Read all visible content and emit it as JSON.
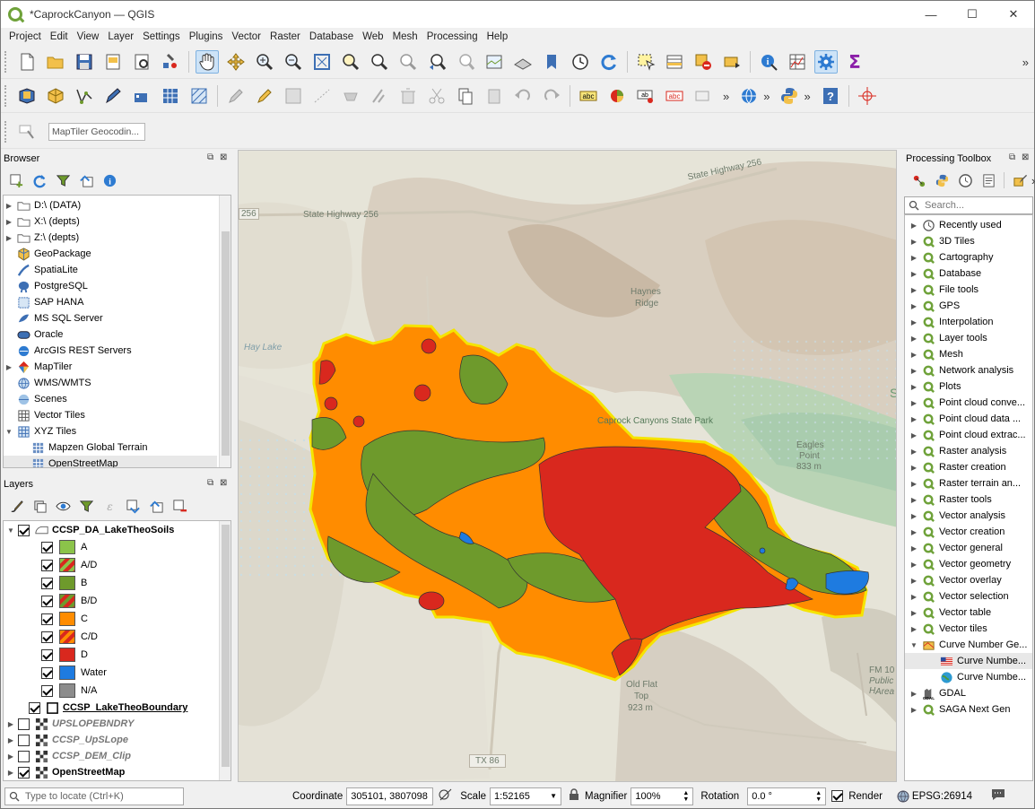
{
  "window": {
    "title": "*CaprockCanyon — QGIS",
    "minimize": "—",
    "maximize": "☐",
    "close": "✕"
  },
  "menu": [
    "Project",
    "Edit",
    "View",
    "Layer",
    "Settings",
    "Plugins",
    "Vector",
    "Raster",
    "Database",
    "Web",
    "Mesh",
    "Processing",
    "Help"
  ],
  "toolbar3": {
    "geocoding_placeholder": "MapTiler Geocodin..."
  },
  "browser": {
    "title": "Browser",
    "items": [
      {
        "label": "D:\\ (DATA)",
        "icon": "folder-icon",
        "arrow": "▶",
        "indent": 0
      },
      {
        "label": "X:\\ (depts)",
        "icon": "folder-icon",
        "arrow": "▶",
        "indent": 0
      },
      {
        "label": "Z:\\ (depts)",
        "icon": "folder-icon",
        "arrow": "▶",
        "indent": 0
      },
      {
        "label": "GeoPackage",
        "icon": "geopackage-icon",
        "arrow": "",
        "indent": 0
      },
      {
        "label": "SpatiaLite",
        "icon": "spatialite-icon",
        "arrow": "",
        "indent": 0
      },
      {
        "label": "PostgreSQL",
        "icon": "postgresql-icon",
        "arrow": "",
        "indent": 0
      },
      {
        "label": "SAP HANA",
        "icon": "sap-hana-icon",
        "arrow": "",
        "indent": 0
      },
      {
        "label": "MS SQL Server",
        "icon": "mssql-icon",
        "arrow": "",
        "indent": 0
      },
      {
        "label": "Oracle",
        "icon": "oracle-icon",
        "arrow": "",
        "indent": 0
      },
      {
        "label": "ArcGIS REST Servers",
        "icon": "arcgis-icon",
        "arrow": "",
        "indent": 0
      },
      {
        "label": "MapTiler",
        "icon": "maptiler-icon",
        "arrow": "▶",
        "indent": 0
      },
      {
        "label": "WMS/WMTS",
        "icon": "wms-icon",
        "arrow": "",
        "indent": 0
      },
      {
        "label": "Scenes",
        "icon": "scenes-icon",
        "arrow": "",
        "indent": 0
      },
      {
        "label": "Vector Tiles",
        "icon": "vector-tiles-icon",
        "arrow": "",
        "indent": 0
      },
      {
        "label": "XYZ Tiles",
        "icon": "xyz-tiles-icon",
        "arrow": "▼",
        "indent": 0
      },
      {
        "label": "Mapzen Global Terrain",
        "icon": "tile-layer-icon",
        "arrow": "",
        "indent": 1
      },
      {
        "label": "OpenStreetMap",
        "icon": "tile-layer-icon",
        "arrow": "",
        "indent": 1
      }
    ]
  },
  "layers": {
    "title": "Layers",
    "items": [
      {
        "label": "CCSP_DA_LakeTheoSoils",
        "type": "group-layer",
        "checked": true,
        "bold": true,
        "italic": false
      },
      {
        "label": "A",
        "type": "class",
        "checked": true,
        "color": "#8bc34a",
        "color2": ""
      },
      {
        "label": "A/D",
        "type": "class",
        "checked": true,
        "color": "#8bc34a",
        "color2": "#d9281e"
      },
      {
        "label": "B",
        "type": "class",
        "checked": true,
        "color": "#6e9a2c",
        "color2": ""
      },
      {
        "label": "B/D",
        "type": "class",
        "checked": true,
        "color": "#6e9a2c",
        "color2": "#d9281e"
      },
      {
        "label": "C",
        "type": "class",
        "checked": true,
        "color": "#ff8c00",
        "color2": ""
      },
      {
        "label": "C/D",
        "type": "class",
        "checked": true,
        "color": "#ff8c00",
        "color2": "#d9281e"
      },
      {
        "label": "D",
        "type": "class",
        "checked": true,
        "color": "#d9281e",
        "color2": ""
      },
      {
        "label": "Water",
        "type": "class",
        "checked": true,
        "color": "#1e7be0",
        "color2": ""
      },
      {
        "label": "N/A",
        "type": "class",
        "checked": true,
        "color": "#8c8c8c",
        "color2": ""
      },
      {
        "label": "CCSP_LakeTheoBoundary",
        "type": "polygon-layer",
        "checked": true,
        "bold": true,
        "italic": false
      },
      {
        "label": "UPSLOPEBNDRY",
        "type": "raster-layer",
        "checked": false,
        "bold": true,
        "italic": true
      },
      {
        "label": "CCSP_UpSLope",
        "type": "raster-layer",
        "checked": false,
        "bold": true,
        "italic": true
      },
      {
        "label": "CCSP_DEM_Clip",
        "type": "raster-layer",
        "checked": false,
        "bold": true,
        "italic": true
      },
      {
        "label": "OpenStreetMap",
        "type": "raster-layer",
        "checked": true,
        "bold": true,
        "italic": false
      }
    ]
  },
  "map_labels": {
    "highway_top": "State Highway 256",
    "highway_mid": "State Highway 256",
    "shield_256": "256",
    "hay_lake": "Hay Lake",
    "haynes_1": "Haynes",
    "haynes_2": "Ridge",
    "park": "Caprock Canyons State Park",
    "eagles_1": "Eagles",
    "eagles_2": "Point",
    "eagles_3": "833 m",
    "oldflat_1": "Old Flat",
    "oldflat_2": "Top",
    "oldflat_3": "923 m",
    "fm_1": "FM 10",
    "fm_2": "Public H",
    "fm_3": "Area",
    "tx86": "TX 86",
    "edge_s": "S"
  },
  "toolbox": {
    "title": "Processing Toolbox",
    "search_placeholder": "Search...",
    "items": [
      {
        "label": "Recently used",
        "icon": "clock-icon",
        "arrow": "▶",
        "indent": 0
      },
      {
        "label": "3D Tiles",
        "icon": "qgis-q-icon",
        "arrow": "▶",
        "indent": 0
      },
      {
        "label": "Cartography",
        "icon": "qgis-q-icon",
        "arrow": "▶",
        "indent": 0
      },
      {
        "label": "Database",
        "icon": "qgis-q-icon",
        "arrow": "▶",
        "indent": 0
      },
      {
        "label": "File tools",
        "icon": "qgis-q-icon",
        "arrow": "▶",
        "indent": 0
      },
      {
        "label": "GPS",
        "icon": "qgis-q-icon",
        "arrow": "▶",
        "indent": 0
      },
      {
        "label": "Interpolation",
        "icon": "qgis-q-icon",
        "arrow": "▶",
        "indent": 0
      },
      {
        "label": "Layer tools",
        "icon": "qgis-q-icon",
        "arrow": "▶",
        "indent": 0
      },
      {
        "label": "Mesh",
        "icon": "qgis-q-icon",
        "arrow": "▶",
        "indent": 0
      },
      {
        "label": "Network analysis",
        "icon": "qgis-q-icon",
        "arrow": "▶",
        "indent": 0
      },
      {
        "label": "Plots",
        "icon": "qgis-q-icon",
        "arrow": "▶",
        "indent": 0
      },
      {
        "label": "Point cloud conve...",
        "icon": "qgis-q-icon",
        "arrow": "▶",
        "indent": 0
      },
      {
        "label": "Point cloud data ...",
        "icon": "qgis-q-icon",
        "arrow": "▶",
        "indent": 0
      },
      {
        "label": "Point cloud extrac...",
        "icon": "qgis-q-icon",
        "arrow": "▶",
        "indent": 0
      },
      {
        "label": "Raster analysis",
        "icon": "qgis-q-icon",
        "arrow": "▶",
        "indent": 0
      },
      {
        "label": "Raster creation",
        "icon": "qgis-q-icon",
        "arrow": "▶",
        "indent": 0
      },
      {
        "label": "Raster terrain an...",
        "icon": "qgis-q-icon",
        "arrow": "▶",
        "indent": 0
      },
      {
        "label": "Raster tools",
        "icon": "qgis-q-icon",
        "arrow": "▶",
        "indent": 0
      },
      {
        "label": "Vector analysis",
        "icon": "qgis-q-icon",
        "arrow": "▶",
        "indent": 0
      },
      {
        "label": "Vector creation",
        "icon": "qgis-q-icon",
        "arrow": "▶",
        "indent": 0
      },
      {
        "label": "Vector general",
        "icon": "qgis-q-icon",
        "arrow": "▶",
        "indent": 0
      },
      {
        "label": "Vector geometry",
        "icon": "qgis-q-icon",
        "arrow": "▶",
        "indent": 0
      },
      {
        "label": "Vector overlay",
        "icon": "qgis-q-icon",
        "arrow": "▶",
        "indent": 0
      },
      {
        "label": "Vector selection",
        "icon": "qgis-q-icon",
        "arrow": "▶",
        "indent": 0
      },
      {
        "label": "Vector table",
        "icon": "qgis-q-icon",
        "arrow": "▶",
        "indent": 0
      },
      {
        "label": "Vector tiles",
        "icon": "qgis-q-icon",
        "arrow": "▶",
        "indent": 0
      },
      {
        "label": "Curve Number Ge...",
        "icon": "plugin-icon",
        "arrow": "▼",
        "indent": 0
      },
      {
        "label": "Curve Numbe...",
        "icon": "us-flag-icon",
        "arrow": "",
        "indent": 1
      },
      {
        "label": "Curve Numbe...",
        "icon": "globe-icon",
        "arrow": "",
        "indent": 1
      },
      {
        "label": "GDAL",
        "icon": "gdal-icon",
        "arrow": "▶",
        "indent": 0
      },
      {
        "label": "SAGA Next Gen",
        "icon": "qgis-q-icon",
        "arrow": "▶",
        "indent": 0
      }
    ]
  },
  "status": {
    "locate_placeholder": "Type to locate (Ctrl+K)",
    "coordinate_label": "Coordinate",
    "coordinate_value": "305101, 3807098",
    "scale_label": "Scale",
    "scale_value": "1:52165",
    "magnifier_label": "Magnifier",
    "magnifier_value": "100%",
    "rotation_label": "Rotation",
    "rotation_value": "0.0 °",
    "render_label": "Render",
    "crs": "EPSG:26914"
  }
}
